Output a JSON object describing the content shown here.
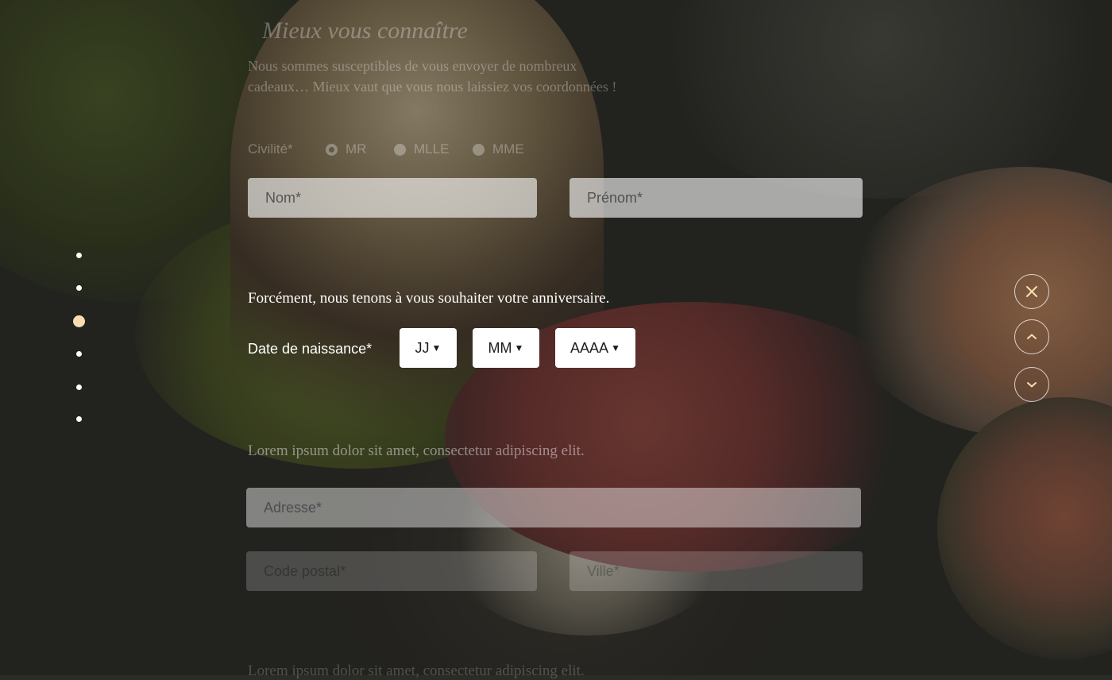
{
  "pager": {
    "total": 6,
    "active_index": 2
  },
  "section_prev": {
    "heading": "Mieux vous connaître",
    "intro": "Nous sommes susceptibles de vous envoyer de nombreux cadeaux… Mieux vaut que vous nous laissiez vos coordonnées !",
    "civility_label": "Civilité*",
    "civility_options": [
      "MR",
      "MLLE",
      "MME"
    ],
    "civility_selected": "MR",
    "lastname_placeholder": "Nom*",
    "firstname_placeholder": "Prénom*"
  },
  "section_birthday": {
    "intro": "Forcément, nous tenons à vous souhaiter votre anniversaire.",
    "birthdate_label": "Date de naissance*",
    "day_select": "JJ",
    "month_select": "MM",
    "year_select": "AAAA"
  },
  "section_address": {
    "intro": "Lorem ipsum dolor sit amet, consectetur adipiscing elit.",
    "address_placeholder": "Adresse*",
    "postal_placeholder": "Code postal*",
    "city_placeholder": "Ville*"
  },
  "section_next": {
    "intro": "Lorem ipsum dolor sit amet, consectetur adipiscing elit."
  },
  "controls": {
    "close_icon": "close-icon",
    "up_icon": "chevron-up-icon",
    "down_icon": "chevron-down-icon"
  },
  "colors": {
    "active_dot": "#f6deb0",
    "control_icon_accent": "#f6deb0"
  }
}
